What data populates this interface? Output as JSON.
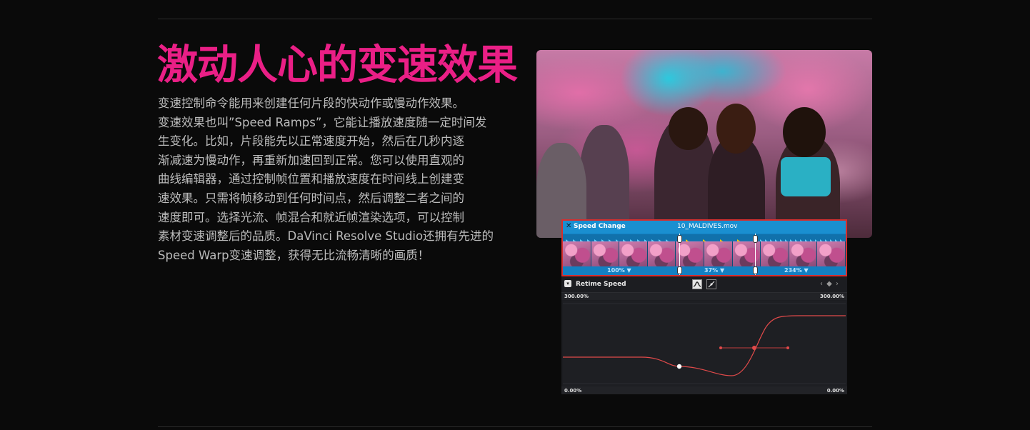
{
  "heading": "激动人心的变速效果",
  "body_lines": [
    "变速控制命令能用来创建任何片段的快动作或慢动作效果。",
    "变速效果也叫”Speed Ramps”，它能让播放速度随一定时间发",
    "生变化。比如，片段能先以正常速度开始，然后在几秒内逐",
    "渐减速为慢动作，再重新加速回到正常。您可以使用直观的",
    "曲线编辑器，通过控制帧位置和播放速度在时间线上创建变",
    "速效果。只需将帧移动到任何时间点，然后调整二者之间的",
    "速度即可。选择光流、帧混合和就近帧渲染选项，可以控制",
    "素材变速调整后的品质。DaVinci Resolve Studio还拥有先进的",
    "Speed Warp变速调整，获得无比流畅清晰的画质！"
  ],
  "timeline": {
    "close_icon": "✕",
    "title": "Speed Change",
    "clip_name": "10_MALDIVES.mov",
    "speeds": [
      "100%",
      "37%",
      "234%"
    ],
    "speed_caret": "▼"
  },
  "curve_editor": {
    "dropdown_icon": "▾",
    "title": "Retime Speed",
    "tool1_icon": "curve-icon",
    "tool2_icon": "pen-icon",
    "nav_icons": "‹ ◆ ›",
    "top_left": "300.00%",
    "top_right": "300.00%",
    "bottom_left": "0.00%",
    "bottom_right": "0.00%"
  },
  "colors": {
    "accent": "#ea1f86",
    "strip_border": "#d62e2e",
    "curve": "#e24a4a"
  }
}
